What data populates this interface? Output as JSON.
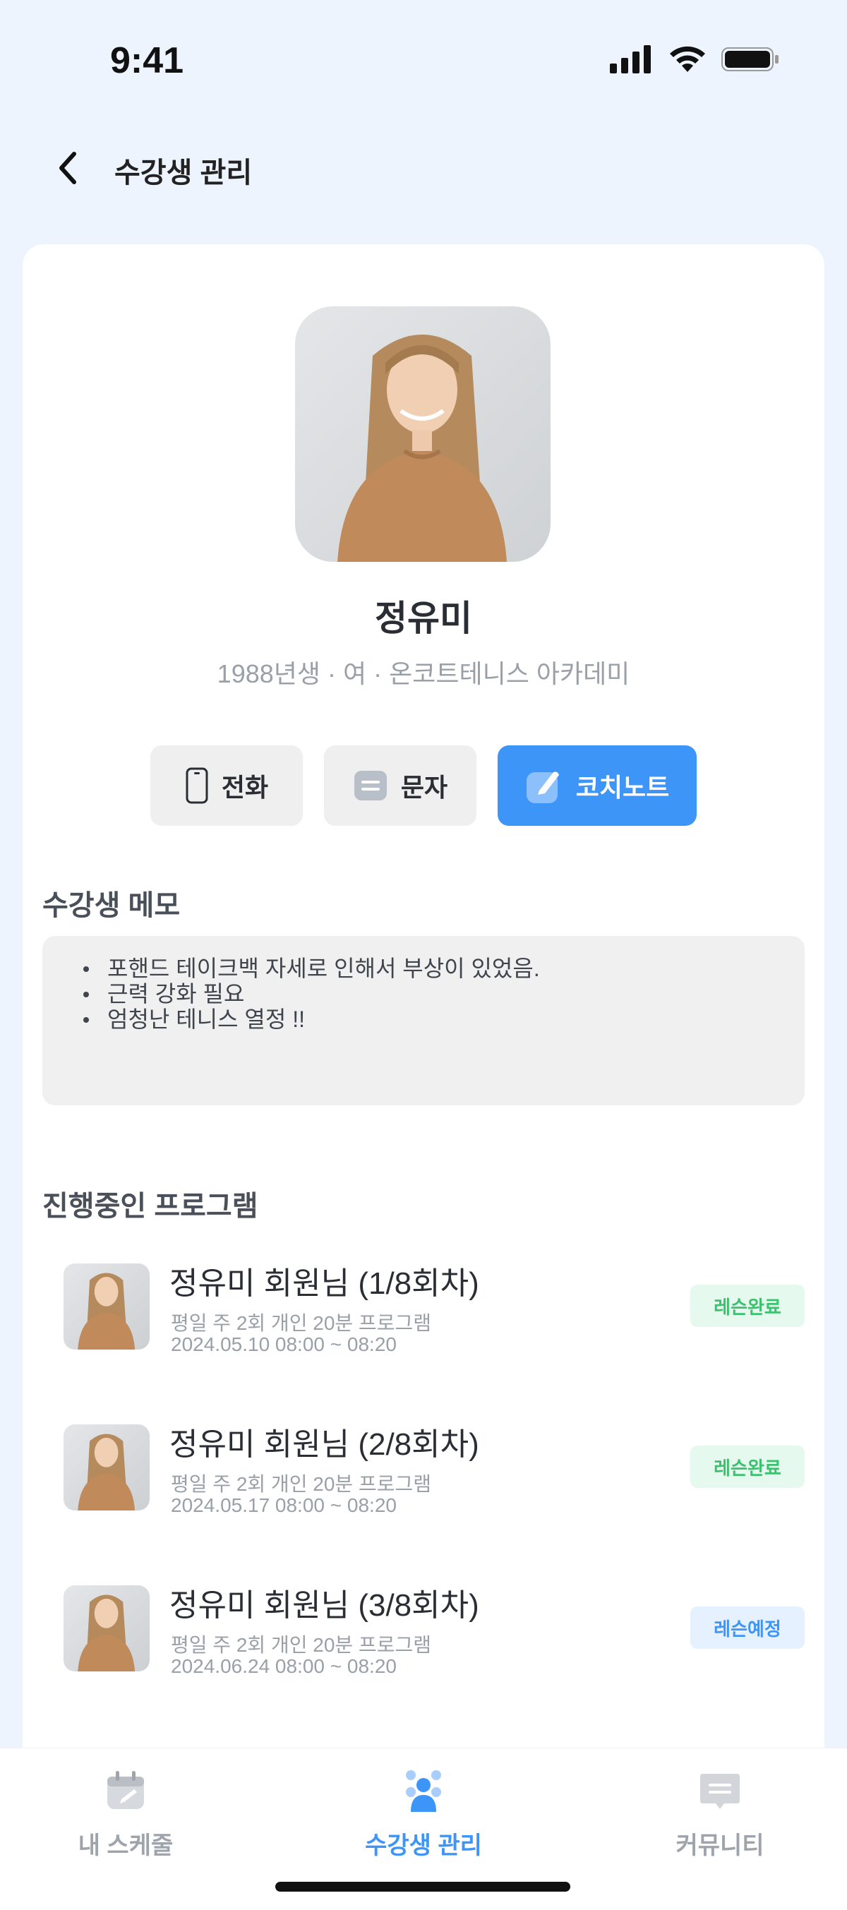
{
  "status_bar": {
    "time": "9:41"
  },
  "header": {
    "title": "수강생 관리"
  },
  "profile": {
    "name": "정유미",
    "info": "1988년생 · 여 · 온코트테니스 아카데미"
  },
  "actions": {
    "call_label": "전화",
    "message_label": "문자",
    "coachnote_label": "코치노트"
  },
  "memo": {
    "title": "수강생 메모",
    "items": [
      "포핸드 테이크백 자세로 인해서 부상이 있었음.",
      "근력 강화 필요",
      "엄청난 테니스 열정 !!"
    ]
  },
  "programs": {
    "title": "진행중인 프로그램",
    "items": [
      {
        "title": "정유미 회원님 (1/8회차)",
        "desc": "평일 주 2회 개인 20분 프로그램",
        "datetime": "2024.05.10 08:00 ~ 08:20",
        "status": "레슨완료"
      },
      {
        "title": "정유미 회원님 (2/8회차)",
        "desc": "평일 주 2회 개인 20분 프로그램",
        "datetime": "2024.05.17 08:00 ~ 08:20",
        "status": "레슨완료"
      },
      {
        "title": "정유미 회원님 (3/8회차)",
        "desc": "평일 주 2회 개인 20분 프로그램",
        "datetime": "2024.06.24 08:00 ~ 08:20",
        "status": "레슨예정"
      }
    ]
  },
  "tab_bar": {
    "tabs": [
      {
        "label": "내 스케줄",
        "icon": "calendar-icon",
        "active": false
      },
      {
        "label": "수강생 관리",
        "icon": "students-icon",
        "active": true
      },
      {
        "label": "커뮤니티",
        "icon": "chat-icon",
        "active": false
      }
    ]
  },
  "colors": {
    "accent": "#3e95f8",
    "background": "#edf4fe",
    "done_badge": "#3cc26e",
    "planned_badge": "#3e95f8"
  }
}
